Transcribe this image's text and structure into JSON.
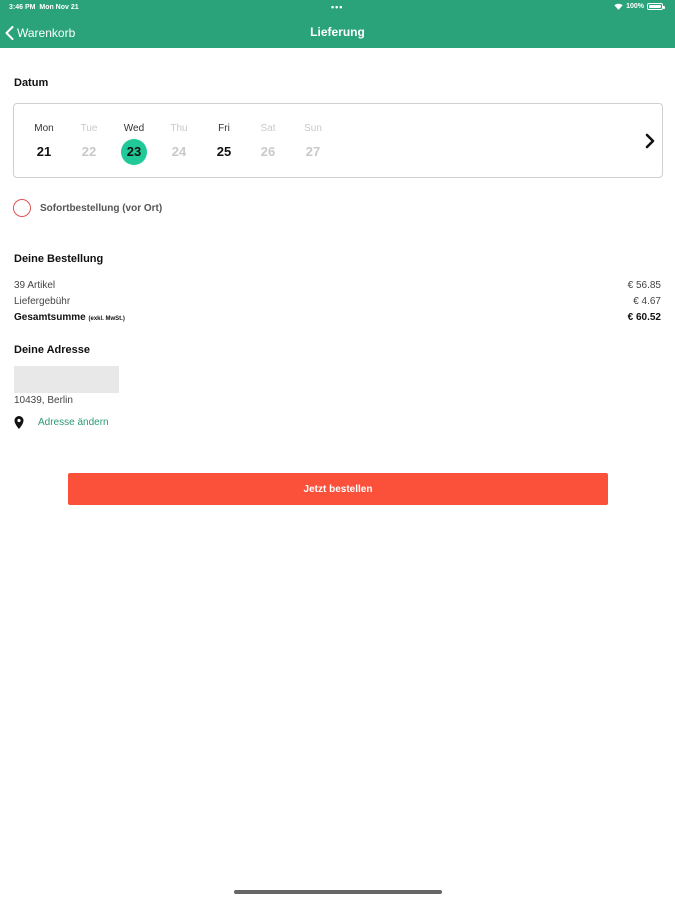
{
  "status_bar": {
    "time": "3:46 PM",
    "date": "Mon Nov 21",
    "dots": "•••",
    "battery": "100%"
  },
  "nav": {
    "back_label": "Warenkorb",
    "title": "Lieferung"
  },
  "datum": {
    "title": "Datum",
    "days": [
      {
        "name": "Mon",
        "num": "21",
        "state": "available"
      },
      {
        "name": "Tue",
        "num": "22",
        "state": "disabled"
      },
      {
        "name": "Wed",
        "num": "23",
        "state": "selected"
      },
      {
        "name": "Thu",
        "num": "24",
        "state": "disabled"
      },
      {
        "name": "Fri",
        "num": "25",
        "state": "available"
      },
      {
        "name": "Sat",
        "num": "26",
        "state": "disabled"
      },
      {
        "name": "Sun",
        "num": "27",
        "state": "disabled"
      }
    ]
  },
  "instant_order": {
    "label": "Sofortbestellung (vor Ort)"
  },
  "order": {
    "title": "Deine Bestellung",
    "items_label": "39 Artikel",
    "items_value": "€ 56.85",
    "fee_label": "Liefergebühr",
    "fee_value": "€ 4.67",
    "total_label": "Gesamtsumme",
    "total_note": "(exkl. MwSt.)",
    "total_value": "€ 60.52"
  },
  "address": {
    "title": "Deine Adresse",
    "city_line": "10439, Berlin",
    "change_label": "Adresse ändern"
  },
  "submit": {
    "label": "Jetzt bestellen"
  },
  "colors": {
    "header": "#2aa37a",
    "selected_day": "#20c997",
    "button": "#fb513b",
    "link": "#2a9a73",
    "radio": "#e25555"
  }
}
